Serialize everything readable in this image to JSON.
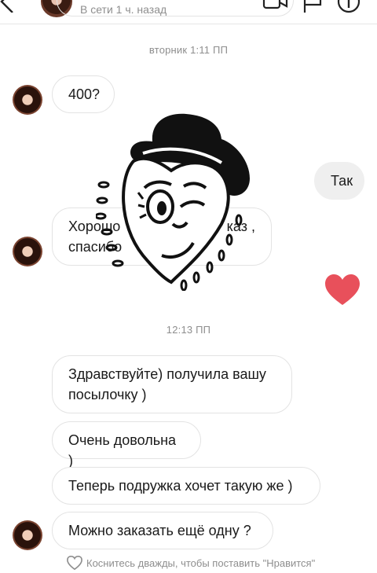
{
  "header": {
    "status": "В сети 1 ч. назад"
  },
  "timestamps": {
    "first": "вторник 1:11 ПП",
    "second": "12:13 ПП"
  },
  "messages": [
    {
      "from": "them",
      "text": "400?"
    },
    {
      "from": "me",
      "text": "Так"
    },
    {
      "from": "them",
      "text": "Хорошо, ... каз , спасибо"
    },
    {
      "from": "me",
      "reaction": "heart"
    },
    {
      "from": "them",
      "text": "Здравствуйте) получила вашу посылочку )"
    },
    {
      "from": "them",
      "text": "Очень довольна )"
    },
    {
      "from": "them",
      "text": "Теперь подружка хочет такую же )"
    },
    {
      "from": "them",
      "text": "Можно заказать ещё одну ?"
    }
  ],
  "bubbles": {
    "m1": "400?",
    "m2": "Так",
    "m3_line1": "Хорошо",
    "m3_line1_tail": "каз ,",
    "m3_line2": "спасибо",
    "m4_line1": "Здравствуйте) получила вашу",
    "m4_line2": "посылочку )",
    "m5": "Очень довольна )",
    "m6": "Теперь подружка хочет такую же )",
    "m7": "Можно заказать ещё одну ?"
  },
  "like_hint": "Коснитесь дважды, чтобы поставить \"Нравится\"",
  "colors": {
    "heart": "#e8505b",
    "my_bubble": "#efefef",
    "muted_text": "#8e8e8e"
  },
  "icons": [
    "back-arrow-icon",
    "video-call-icon",
    "flag-icon",
    "info-icon",
    "heart-icon",
    "heart-outline-icon"
  ]
}
